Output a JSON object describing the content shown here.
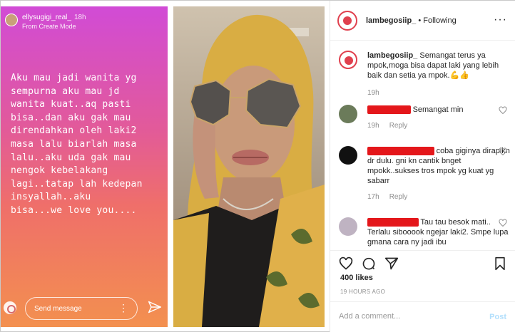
{
  "story": {
    "username": "ellysugigi_real_",
    "time": "18h",
    "subtitle": "From Create Mode",
    "text": "Aku mau jadi wanita yg\nsempurna aku mau jd\nwanita kuat..aq pasti\nbisa..dan aku gak mau\ndirendahkan oleh laki2\nmasa lalu biarlah masa\nlalu..aku uda gak mau\nnengok kebelakang\nlagi..tatap lah kedepan\ninsyallah..aku\nbisa...we love you....",
    "send_placeholder": "Send message"
  },
  "post": {
    "username": "lambegosiip_",
    "follow_status": "• Following",
    "caption": {
      "username": "lambegosiip_",
      "text": "Semangat terus ya mpok,moga bisa dapat laki yang lebih baik dan setia ya mpok.",
      "emoji": "💪👍",
      "time": "19h"
    },
    "comments": [
      {
        "text": "Semangat min",
        "time": "19h",
        "reply": "Reply"
      },
      {
        "text": "coba giginya dirapikn dr dulu. gni kn cantik bnget mpokk..sukses tros mpok yg kuat yg sabarr",
        "time": "17h",
        "reply": "Reply"
      },
      {
        "text": "Tau tau besok mati.. Terlalu sibooook ngejar laki2. Smpe lupa gmana cara ny jadi ibu",
        "time": "",
        "reply": ""
      }
    ],
    "likes": "400 likes",
    "date": "19 HOURS AGO",
    "add_comment_placeholder": "Add a comment...",
    "post_label": "Post"
  },
  "colors": {
    "redaction": "#e4171b",
    "brand_ring": "#e0404e",
    "post_button": "#b2dffc"
  }
}
